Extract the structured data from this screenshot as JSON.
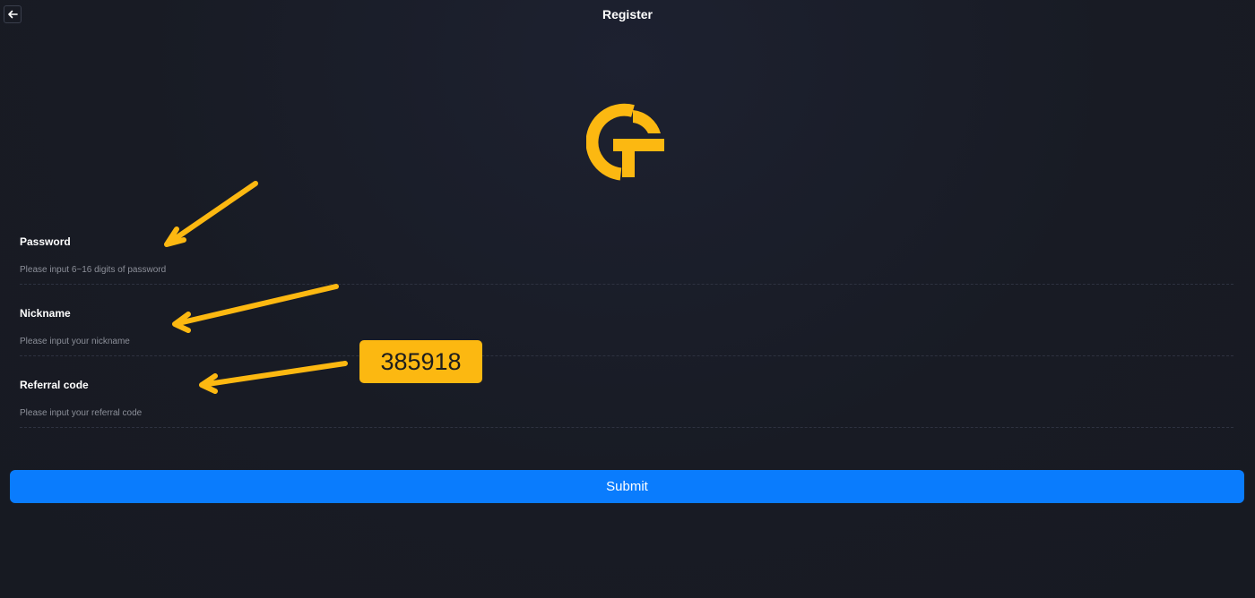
{
  "header": {
    "title": "Register",
    "back_icon": "arrow-left-icon"
  },
  "logo": {
    "icon": "gt-logo-icon",
    "color": "#fcb811"
  },
  "form": {
    "password": {
      "label": "Password",
      "placeholder": "Please input 6~16 digits of password"
    },
    "nickname": {
      "label": "Nickname",
      "placeholder": "Please input your nickname"
    },
    "referral": {
      "label": "Referral code",
      "placeholder": "Please input your referral code"
    }
  },
  "submit": {
    "label": "Submit"
  },
  "annotation": {
    "referral_code": "385918",
    "arrow_color": "#fcb811",
    "badge_color": "#fcb811"
  },
  "colors": {
    "background": "#181b24",
    "accent": "#0a7cfd"
  }
}
